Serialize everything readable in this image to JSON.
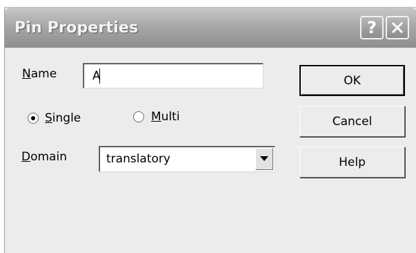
{
  "dialog": {
    "title": "Pin Properties",
    "help_symbol": "?"
  },
  "form": {
    "name_label": "Name",
    "name_mnemonic": "N",
    "name_rest": "ame",
    "name_value": "A",
    "mode_options": [
      {
        "label": "Single",
        "mnemonic": "S",
        "rest": "ingle",
        "checked": true
      },
      {
        "label": "Multi",
        "mnemonic": "M",
        "rest": "ulti",
        "checked": false
      }
    ],
    "domain_label": "Domain",
    "domain_mnemonic": "D",
    "domain_rest": "omain",
    "domain_value": "translatory"
  },
  "buttons": {
    "ok": "OK",
    "cancel": "Cancel",
    "help": "Help"
  },
  "icons": {
    "help": "help-icon",
    "close": "close-icon",
    "dropdown": "chevron-down-icon"
  }
}
